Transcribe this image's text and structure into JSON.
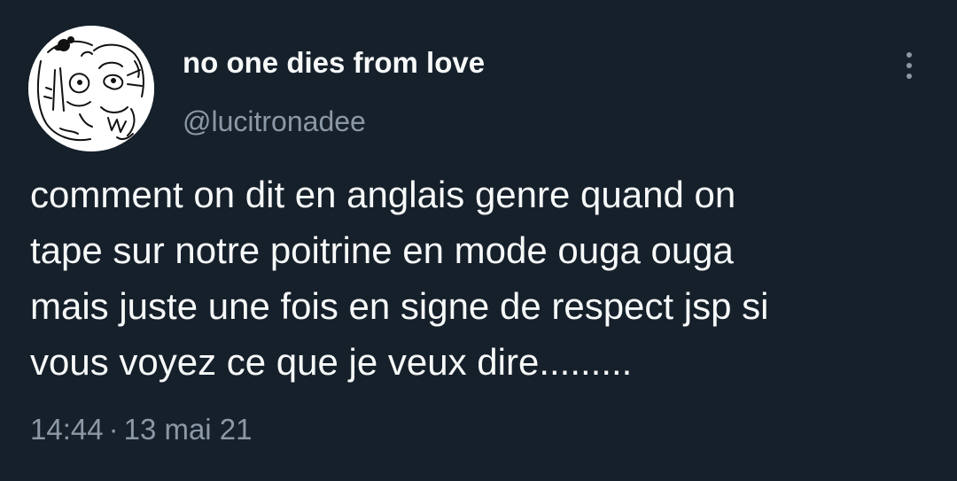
{
  "author": {
    "display_name": "no one dies from love",
    "handle": "@lucitronadee",
    "avatar_icon": "doodle-portrait-avatar"
  },
  "more_icon": "more-vertical-icon",
  "tweet": {
    "lines": [
      "comment on dit en anglais genre quand on",
      "tape sur notre poitrine en mode ouga ouga",
      "mais juste une fois en signe de respect jsp si",
      "vous voyez ce que je veux dire........."
    ],
    "time": "14:44",
    "separator": "·",
    "date": "13 mai 21"
  },
  "colors": {
    "background": "#15202b",
    "primary_text": "#f7f9f9",
    "secondary_text": "#8b98a5"
  }
}
